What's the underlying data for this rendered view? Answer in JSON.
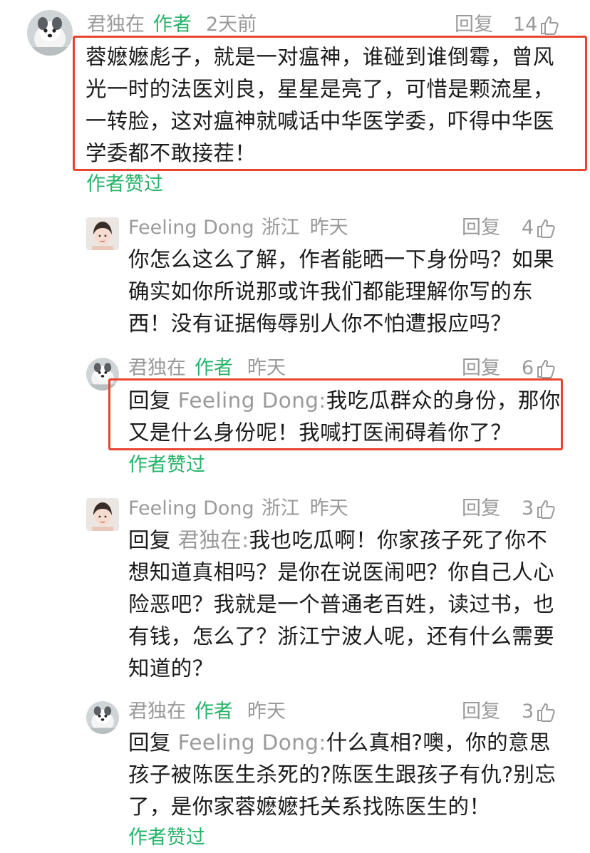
{
  "comments": [
    {
      "user": "君独在",
      "badge": "作者",
      "time": "2天前",
      "reply": "回复",
      "likes": "14",
      "lines": [
        "蓉嬷嬷彪子，就是一对瘟神，谁碰到谁倒霉，曾风",
        "光一时的法医刘良，星星是亮了，可惜是颗流星，",
        "一转脸，这对瘟神就喊话中华医学委，吓得中华医",
        "学委都不敢接茬！"
      ],
      "liked": "作者赞过"
    },
    {
      "user": "Feeling Dong",
      "place": "浙江",
      "time": "昨天",
      "reply": "回复",
      "likes": "4",
      "lines": [
        "你怎么这么了解，作者能晒一下身份吗？如果",
        "确实如你所说那或许我们都能理解你写的东",
        "西！没有证据侮辱别人你不怕遭报应吗？"
      ]
    },
    {
      "user": "君独在",
      "badge": "作者",
      "time": "昨天",
      "reply": "回复",
      "likes": "6",
      "reply_prefix": "回复",
      "reply_to": "Feeling Dong:",
      "lines": [
        "我吃瓜群众的身份，那你",
        "又是什么身份呢！我喊打医闹碍着你了？"
      ],
      "liked": "作者赞过"
    },
    {
      "user": "Feeling Dong",
      "place": "浙江",
      "time": "昨天",
      "reply": "回复",
      "likes": "3",
      "reply_prefix": "回复",
      "reply_to": "君独在:",
      "lines": [
        "我也吃瓜啊！你家孩子死了你不",
        "想知道真相吗？是你在说医闹吧？你自己人心",
        "险恶吧？我就是一个普通老百姓，读过书，也",
        "有钱，怎么了？浙江宁波人呢，还有什么需要",
        "知道的？"
      ]
    },
    {
      "user": "君独在",
      "badge": "作者",
      "time": "昨天",
      "reply": "回复",
      "likes": "3",
      "reply_prefix": "回复",
      "reply_to": "Feeling Dong:",
      "lines": [
        "什么真相?噢，你的意思",
        "孩子被陈医生杀死的?陈医生跟孩子有仇?别忘",
        "了，是你家蓉嬷嬷托关系找陈医生的！"
      ],
      "liked": "作者赞过"
    }
  ],
  "colors": {
    "accent_green": "#27b36a",
    "highlight_red": "#e8442f",
    "meta_gray": "#9a9a9a",
    "text": "#1b1b1b"
  },
  "icons": [
    "thumbs-up-icon",
    "dog-avatar",
    "woman-avatar"
  ]
}
